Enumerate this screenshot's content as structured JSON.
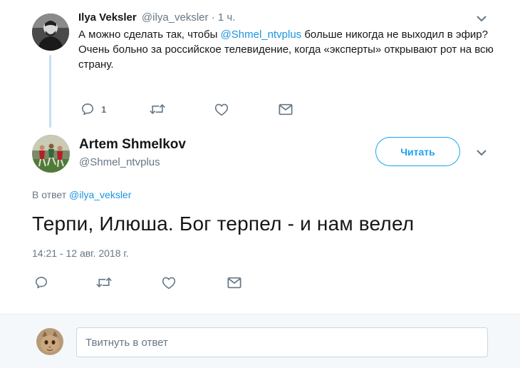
{
  "parent_tweet": {
    "author_name": "Ilya Veksler",
    "author_handle": "@ilya_veksler",
    "separator": "·",
    "time": "1 ч.",
    "text_before_mention": "А можно сделать так, чтобы ",
    "mention": "@Shmel_ntvplus",
    "text_after_mention": " больше никогда не выходил в эфир?",
    "text_paragraph2": "Очень больно за российское телевидение, когда «эксперты» открывают рот на всю страну.",
    "reply_count": "1",
    "avatar_icon": "person-photo-avatar"
  },
  "main_tweet": {
    "author_name": "Artem Shmelkov",
    "author_handle": "@Shmel_ntvplus",
    "follow_label": "Читать",
    "reply_to_prefix": "В ответ ",
    "reply_to_handle": "@ilya_veksler",
    "text": "Терпи, Илюша. Бог терпел - и нам велел",
    "timestamp": "14:21 - 12 авг. 2018 г.",
    "avatar_icon": "football-players-avatar"
  },
  "reply_composer": {
    "placeholder": "Твитнуть в ответ",
    "avatar_icon": "cat-avatar"
  },
  "icons": {
    "reply": "reply-icon",
    "retweet": "retweet-icon",
    "like": "heart-icon",
    "dm": "envelope-icon",
    "menu": "chevron-down-icon"
  },
  "colors": {
    "link": "#1b95e0",
    "accent": "#1da1f2",
    "muted": "#657786",
    "thread_line": "#c4dff4",
    "composer_bg": "#f5f8fa"
  }
}
